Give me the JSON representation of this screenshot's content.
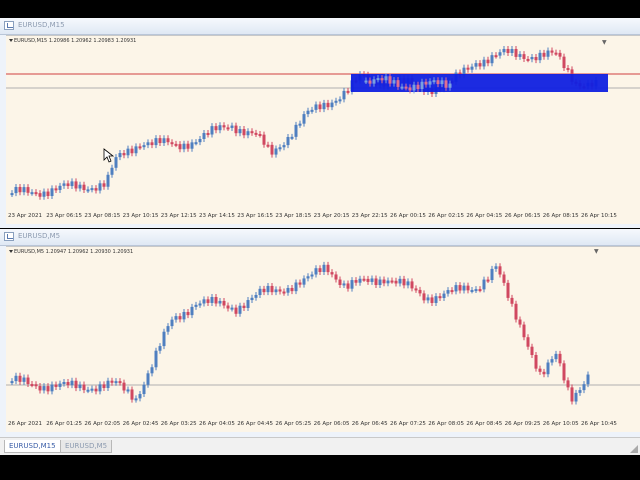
{
  "windows": [
    {
      "title": "EURUSD,M15",
      "info": "EURUSD,M15  1.20986 1.20962 1.20983 1.20931",
      "xticks": [
        "23 Apr 2021",
        "23 Apr 06:15",
        "23 Apr 08:15",
        "23 Apr 10:15",
        "23 Apr 12:15",
        "23 Apr 14:15",
        "23 Apr 16:15",
        "23 Apr 18:15",
        "23 Apr 20:15",
        "23 Apr 22:15",
        "26 Apr 00:15",
        "26 Apr 02:15",
        "26 Apr 04:15",
        "26 Apr 06:15",
        "26 Apr 08:15",
        "26 Apr 10:15"
      ]
    },
    {
      "title": "EURUSD,M5",
      "info": "EURUSD,M5  1.20947 1.20962 1.20930 1.20931",
      "xticks": [
        "26 Apr 2021",
        "26 Apr 01:25",
        "26 Apr 02:05",
        "26 Apr 02:45",
        "26 Apr 03:25",
        "26 Apr 04:05",
        "26 Apr 04:45",
        "26 Apr 05:25",
        "26 Apr 06:05",
        "26 Apr 06:45",
        "26 Apr 07:25",
        "26 Apr 08:05",
        "26 Apr 08:45",
        "26 Apr 09:25",
        "26 Apr 10:05",
        "26 Apr 10:45"
      ]
    }
  ],
  "tabs": [
    {
      "label": "EURUSD,M15",
      "active": true
    },
    {
      "label": "EURUSD,M5",
      "active": false
    }
  ],
  "colors": {
    "bull": "#4f7fc0",
    "bear": "#d04860",
    "selection": "#1020e0",
    "hline_red": "#d04040",
    "hline_gray": "#b0b0b0",
    "chart_bg": "#fcf5e8"
  },
  "icons": {
    "window": "chart-window-icon",
    "cursor": "mouse-pointer-icon",
    "shift": "chart-shift-triangle-icon"
  }
}
